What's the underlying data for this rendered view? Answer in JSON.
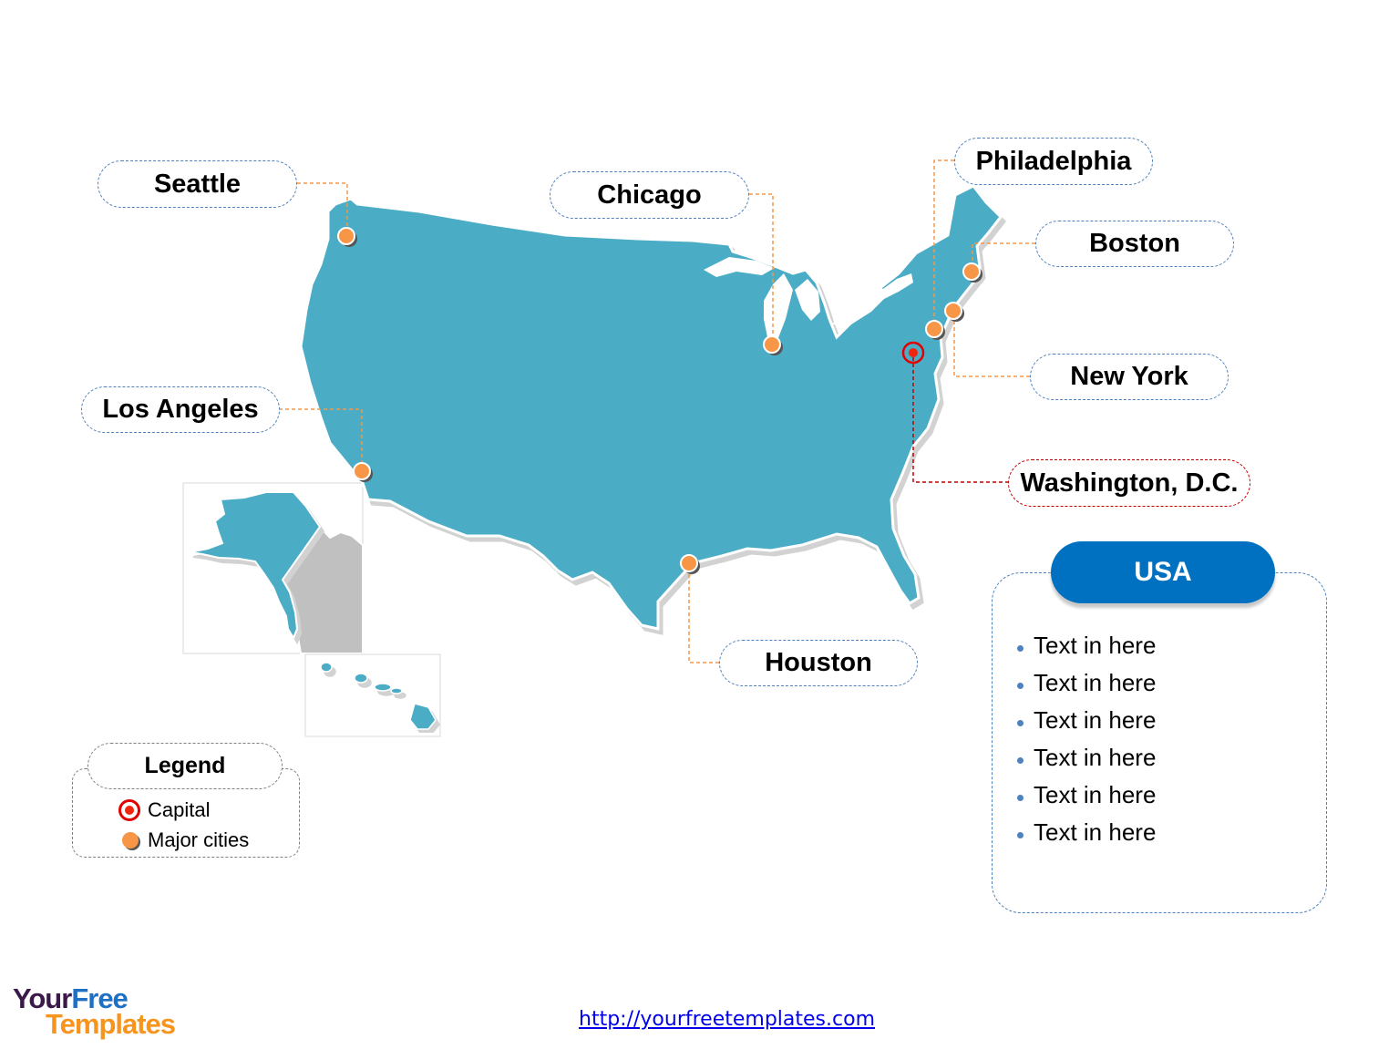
{
  "title": "USA",
  "colors": {
    "land": "#4bacc6",
    "land_shadow": "#d0d0d0",
    "neighbor": "#c0c0c0",
    "city_marker": "#f79646",
    "capital_marker": "#e00000",
    "city_leader": "#f79646",
    "capital_leader": "#c00000",
    "label_border": "#4f81bd",
    "panel_header": "#0070c0"
  },
  "cities": [
    {
      "name": "Seattle",
      "type": "major"
    },
    {
      "name": "Chicago",
      "type": "major"
    },
    {
      "name": "Philadelphia",
      "type": "major"
    },
    {
      "name": "Boston",
      "type": "major"
    },
    {
      "name": "New York",
      "type": "major"
    },
    {
      "name": "Washington, D.C.",
      "type": "capital"
    },
    {
      "name": "Los Angeles",
      "type": "major"
    },
    {
      "name": "Houston",
      "type": "major"
    }
  ],
  "insets": [
    "Alaska",
    "Hawaii"
  ],
  "info_panel": {
    "title": "USA",
    "items": [
      "Text in here",
      "Text in here",
      "Text in here",
      "Text in here",
      "Text in here",
      "Text in here"
    ]
  },
  "legend": {
    "title": "Legend",
    "items": [
      {
        "label": "Capital",
        "icon": "capital-marker-icon"
      },
      {
        "label": "Major cities",
        "icon": "city-marker-icon"
      }
    ]
  },
  "footer": {
    "logo_line1_a": "Your",
    "logo_line1_b": "Free",
    "logo_line2": "Templates",
    "url": "http://yourfreetemplates.com"
  }
}
